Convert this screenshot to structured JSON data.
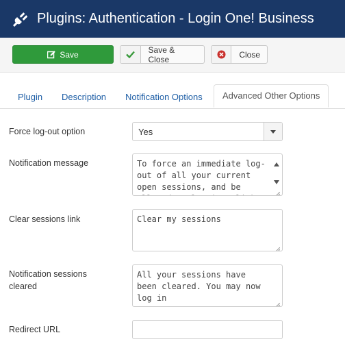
{
  "header": {
    "title": "Plugins: Authentication - Login One! Business",
    "icon": "plug-icon"
  },
  "toolbar": {
    "save_label": "Save",
    "save_close_label": "Save & Close",
    "close_label": "Close"
  },
  "tabs": [
    {
      "label": "Plugin",
      "active": false
    },
    {
      "label": "Description",
      "active": false
    },
    {
      "label": "Notification Options",
      "active": false
    },
    {
      "label": "Advanced Other Options",
      "active": true
    }
  ],
  "form": {
    "force_logout": {
      "label": "Force log-out option",
      "value": "Yes"
    },
    "notification_message": {
      "label": "Notification message",
      "value": "To force an immediate log-out of all your current open sessions, and be allowed to log in, click"
    },
    "clear_sessions_link": {
      "label": "Clear sessions link",
      "value": "Clear my sessions"
    },
    "notification_sessions_cleared": {
      "label": "Notification sessions cleared",
      "value": "All your sessions have been cleared. You may now log in"
    },
    "redirect_url": {
      "label": "Redirect URL",
      "value": ""
    }
  },
  "colors": {
    "header_bg": "#1a3867",
    "save_green": "#2f9a3b",
    "tab_link": "#1f5fa6",
    "close_red": "#c9302c"
  }
}
